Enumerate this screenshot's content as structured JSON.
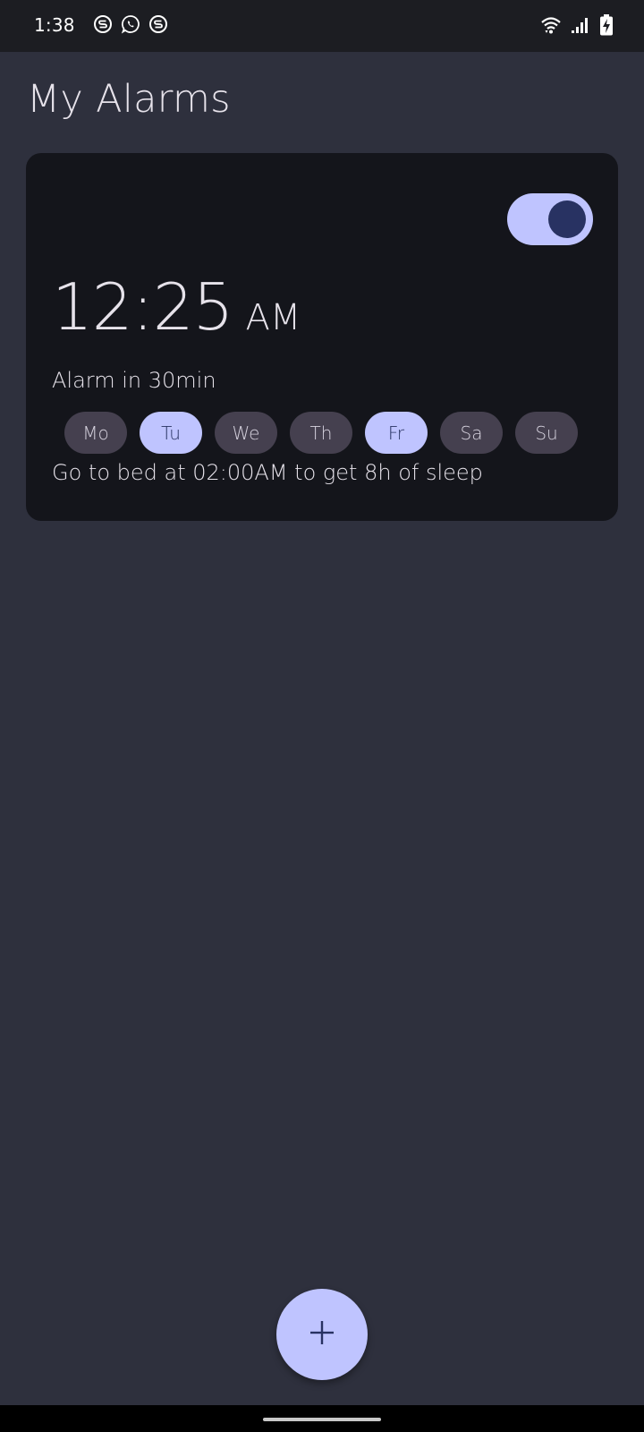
{
  "status_bar": {
    "time": "1:38",
    "left_icons": [
      "s-app-icon",
      "whatsapp-icon",
      "s-app-icon"
    ],
    "right_icons": [
      "wifi-icon",
      "cellular-signal-icon",
      "battery-charging-icon"
    ]
  },
  "header": {
    "title": "My Alarms"
  },
  "alarm": {
    "enabled": true,
    "time": "12:25",
    "ampm": "AM",
    "countdown": "Alarm in 30min",
    "days": [
      {
        "label": "Mo",
        "selected": false
      },
      {
        "label": "Tu",
        "selected": true
      },
      {
        "label": "We",
        "selected": false
      },
      {
        "label": "Th",
        "selected": false
      },
      {
        "label": "Fr",
        "selected": true
      },
      {
        "label": "Sa",
        "selected": false
      },
      {
        "label": "Su",
        "selected": false
      }
    ],
    "bedtime_hint": "Go to bed at 02:00AM to get 8h of sleep"
  },
  "fab": {
    "icon": "plus-icon"
  },
  "colors": {
    "background": "#2e303d",
    "card": "#14151b",
    "accent": "#bfc4ff",
    "accent_dark": "#283262",
    "chip_unselected": "#45404f"
  }
}
